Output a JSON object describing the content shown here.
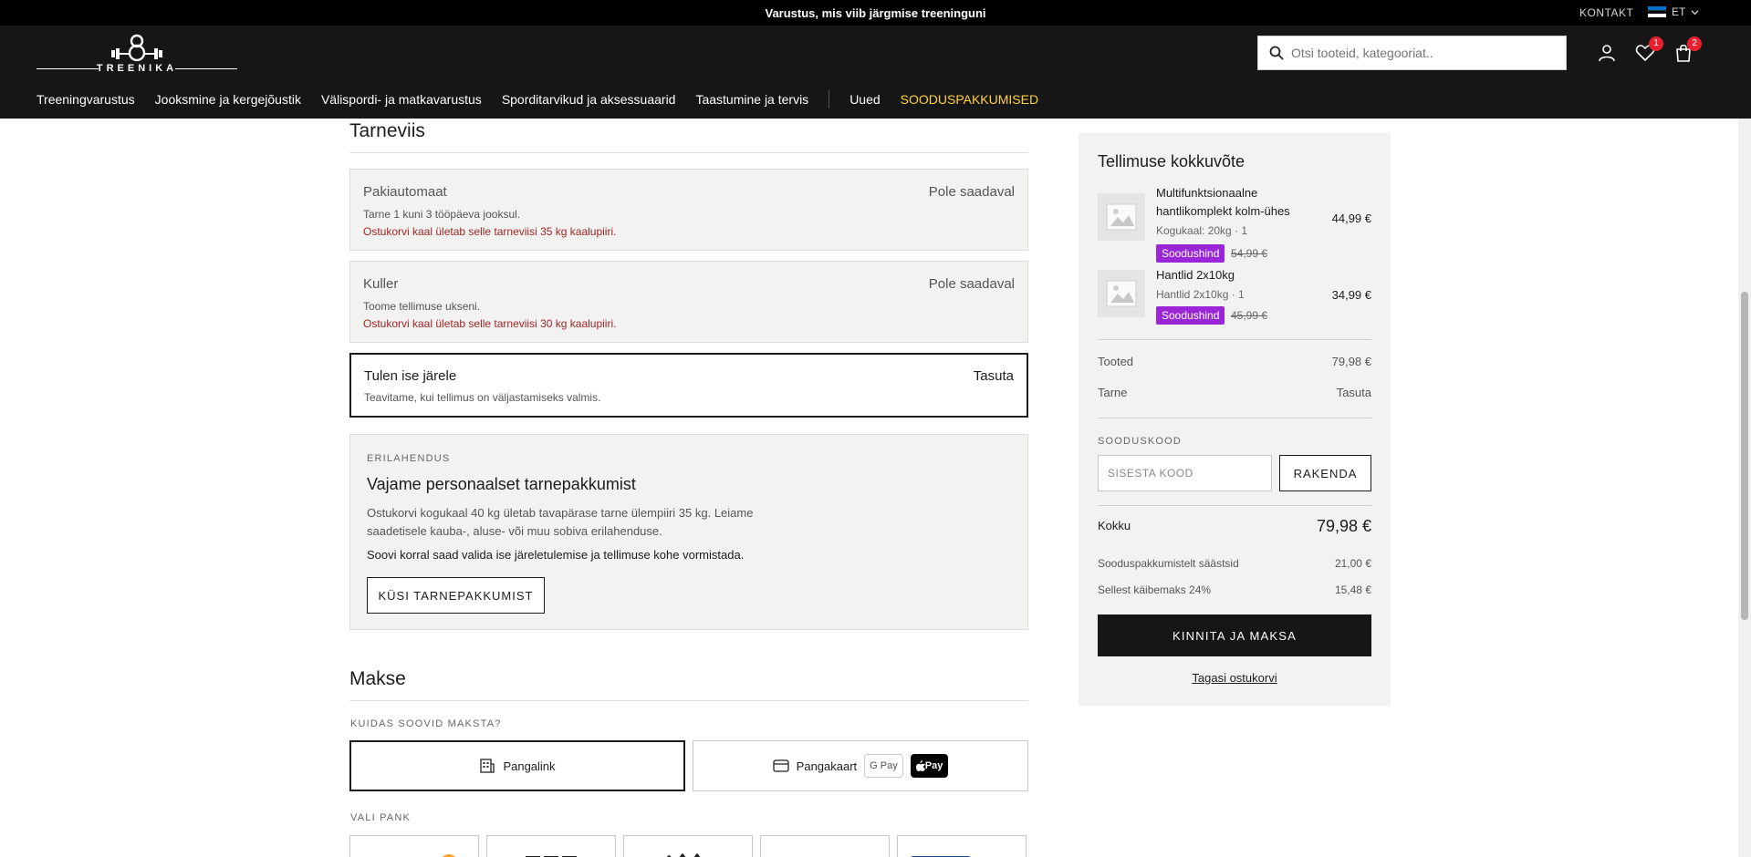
{
  "topbar": {
    "promo": "Varustus, mis viib järgmise treeninguni",
    "contact": "KONTAKT",
    "language": "ET",
    "flag_colors": [
      "#0072ce",
      "#000000",
      "#ffffff"
    ]
  },
  "header": {
    "logo_text": "TREENIKA",
    "search_placeholder": "Otsi tooteid, kategooriat..",
    "wishlist_count": "1",
    "cart_count": "2"
  },
  "nav": {
    "items": [
      "Treeningvarustus",
      "Jooksmine ja kergejõustik",
      "Välispordi- ja matkavarustus",
      "Sporditarvikud ja aksessuaarid",
      "Taastumine ja tervis"
    ],
    "new_label": "Uued",
    "sale_label": "SOODUSPAKKUMISED"
  },
  "delivery": {
    "title": "Tarneviis",
    "options": [
      {
        "name": "Pakiautomaat",
        "price": "Pole saadaval",
        "desc": "Tarne 1 kuni 3 tööpäeva jooksul.",
        "warning": "Ostukorvi kaal ületab selle tarneviisi 35 kg kaalupiiri."
      },
      {
        "name": "Kuller",
        "price": "Pole saadaval",
        "desc": "Toome tellimuse ukseni.",
        "warning": "Ostukorvi kaal ületab selle tarneviisi 30 kg kaalupiiri."
      },
      {
        "name": "Tulen ise järele",
        "price": "Tasuta",
        "desc": "Teavitame, kui tellimus on väljastamiseks valmis.",
        "selected": true
      }
    ],
    "special": {
      "kicker": "ERILAHENDUS",
      "title": "Vajame personaalset tarnepakkumist",
      "body": "Ostukorvi kogukaal 40 kg ületab tavapärase tarne ülempiiri 35 kg. Leiame saadetisele kauba-, aluse- või muu sobiva erilahenduse.",
      "body2": "Soovi korral saad valida ise järeletulemise ja tellimuse kohe vormistada.",
      "button": "KÜSI TARNEPAKKUMIST"
    }
  },
  "payment": {
    "title": "Makse",
    "question": "KUIDAS SOOVID MAKSTA?",
    "methods": [
      {
        "label": "Pangalink",
        "selected": true
      },
      {
        "label": "Pangakaart",
        "badges": [
          "G Pay",
          "Pay"
        ]
      }
    ],
    "bank_label": "VALI PANK"
  },
  "summary": {
    "title": "Tellimuse kokkuvõte",
    "items": [
      {
        "name": "Multifunktsionaalne hantlikomplekt kolm-ühes",
        "meta": "Kogukaal: 20kg · 1",
        "price": "44,99 €",
        "tag": "Soodushind",
        "old_price": "54,99 €"
      },
      {
        "name": "Hantlid 2x10kg",
        "meta": "Hantlid 2x10kg · 1",
        "price": "34,99 €",
        "tag": "Soodushind",
        "old_price": "45,99 €"
      }
    ],
    "products_label": "Tooted",
    "products_value": "79,98 €",
    "shipping_label": "Tarne",
    "shipping_value": "Tasuta",
    "code_label": "SOODUSKOOD",
    "code_placeholder": "SISESTA KOOD",
    "apply_label": "RAKENDA",
    "total_label": "Kokku",
    "total_value": "79,98 €",
    "saved_label": "Sooduspakkumistelt säästsid",
    "saved_value": "21,00 €",
    "vat_label": "Sellest käibemaks 24%",
    "vat_value": "15,48 €",
    "pay_button": "KINNITA JA MAKSA",
    "back_link": "Tagasi ostukorvi"
  },
  "colors": {
    "accent_sale": "#ffd234",
    "tag": "#9b26d8",
    "badge": "#e8202f",
    "warning": "#a02626"
  }
}
